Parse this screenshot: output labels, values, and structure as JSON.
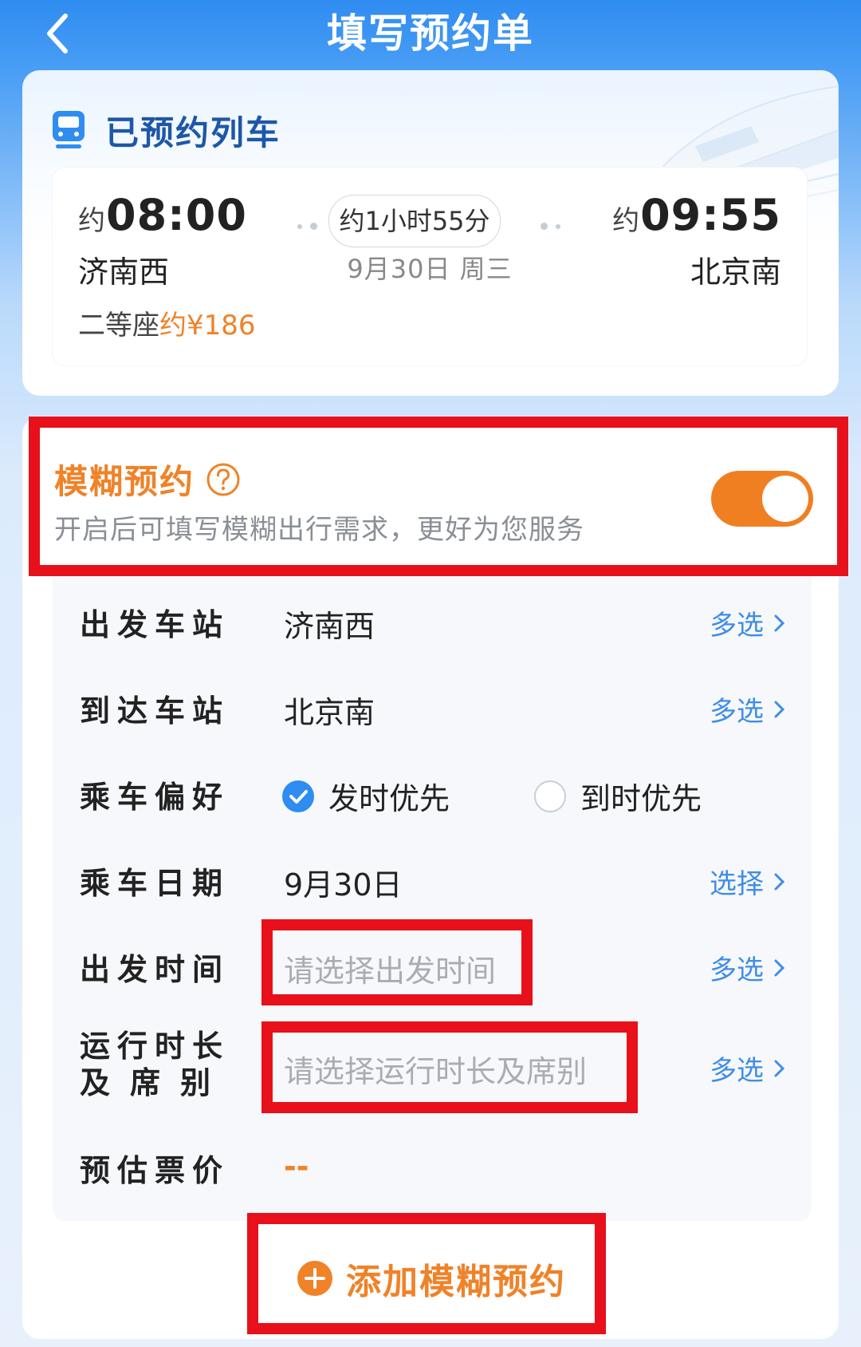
{
  "header": {
    "title": "填写预约单"
  },
  "train_card": {
    "title": "已预约列车",
    "approx_prefix": "约",
    "dep_time": "08:00",
    "arr_time": "09:55",
    "duration": "约1小时55分",
    "date": "9月30日 周三",
    "dep_station": "济南西",
    "arr_station": "北京南",
    "seat_type": "二等座",
    "seat_price": "约¥186"
  },
  "fuzzy": {
    "title": "模糊预约",
    "description": "开启后可填写模糊出行需求，更好为您服务",
    "toggle_on": true
  },
  "form": {
    "dep_station_label": "出发车站",
    "dep_station_value": "济南西",
    "dep_station_action": "多选",
    "arr_station_label": "到达车站",
    "arr_station_value": "北京南",
    "arr_station_action": "多选",
    "pref_label": "乘车偏好",
    "pref_option_1": "发时优先",
    "pref_option_2": "到时优先",
    "pref_selected": 1,
    "date_label": "乘车日期",
    "date_value": "9月30日",
    "date_action": "选择",
    "dep_time_label": "出发时间",
    "dep_time_placeholder": "请选择出发时间",
    "dep_time_action": "多选",
    "duration_label_1": "运行时长",
    "duration_label_2": "及席别",
    "duration_placeholder": "请选择运行时长及席别",
    "duration_action": "多选",
    "price_label": "预估票价",
    "price_value": "--"
  },
  "add_button": {
    "label": "添加模糊预约"
  },
  "colors": {
    "primary_blue": "#2f8cf0",
    "accent_orange": "#f08228",
    "highlight_red": "#e8101a",
    "link_blue": "#3f8de6"
  }
}
